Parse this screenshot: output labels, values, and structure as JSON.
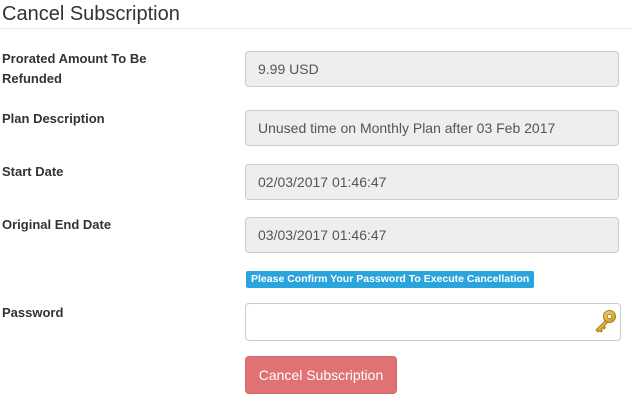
{
  "page": {
    "title": "Cancel Subscription"
  },
  "fields": [
    {
      "label": "Prorated Amount To Be Refunded",
      "value": "9.99 USD"
    },
    {
      "label": "Plan Description",
      "value": "Unused time on Monthly Plan after 03 Feb 2017"
    },
    {
      "label": "Start Date",
      "value": "02/03/2017 01:46:47"
    },
    {
      "label": "Original End Date",
      "value": "03/03/2017 01:46:47"
    }
  ],
  "password": {
    "notice": "Please Confirm Your Password To Execute Cancellation",
    "label": "Password",
    "value": "",
    "placeholder": "",
    "icon": "key-icon"
  },
  "actions": {
    "cancel_label": "Cancel Subscription"
  },
  "colors": {
    "notice_badge": "#2aa4dd",
    "cancel_button": "#e07273",
    "readonly_field": "#eeeeee"
  }
}
